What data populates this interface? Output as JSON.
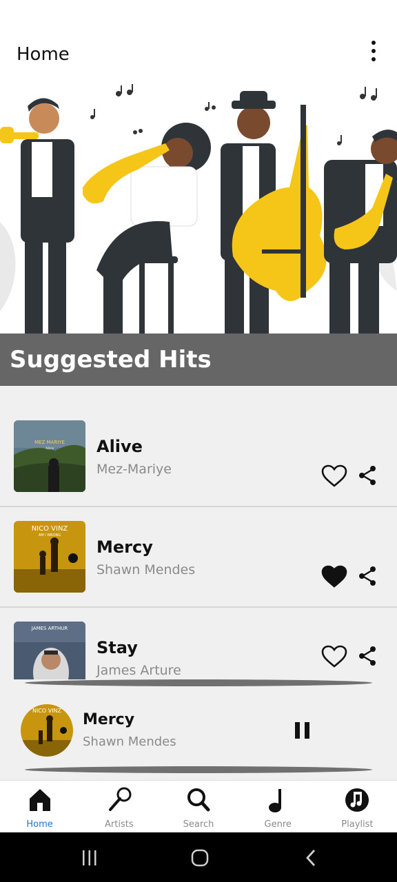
{
  "appbar": {
    "title": "Home"
  },
  "section": {
    "title": "Suggested Hits"
  },
  "songs": [
    {
      "title": "Alive",
      "artist": "Mez-Mariye",
      "liked": false,
      "cover_label": "MEZ MARIYE",
      "cover_sub": "Alive"
    },
    {
      "title": "Mercy",
      "artist": "Shawn Mendes",
      "liked": true,
      "cover_label": "NICO VINZ",
      "cover_sub": "AM I WRONG"
    },
    {
      "title": "Stay",
      "artist": "James Arture",
      "liked": false,
      "cover_label": "JAMES ARTHUR",
      "cover_sub": ""
    }
  ],
  "now_playing": {
    "title": "Mercy",
    "artist": "Shawn Mendes",
    "cover_label": "NICO VINZ"
  },
  "nav": [
    {
      "label": "Home",
      "icon": "home-icon",
      "active": true
    },
    {
      "label": "Artists",
      "icon": "microphone-icon",
      "active": false
    },
    {
      "label": "Search",
      "icon": "search-icon",
      "active": false
    },
    {
      "label": "Genre",
      "icon": "music-note-icon",
      "active": false
    },
    {
      "label": "Playlist",
      "icon": "playlist-icon",
      "active": false
    }
  ],
  "colors": {
    "accent": "#1976d2",
    "section_bar": "#666666",
    "hero_yellow": "#f5c518",
    "suit": "#2f3438"
  }
}
